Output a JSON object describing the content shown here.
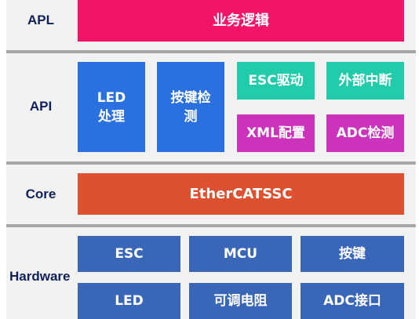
{
  "layers": {
    "apl": {
      "label": "APL",
      "box": {
        "text": "业务逻辑",
        "color": "#f31469"
      }
    },
    "api": {
      "label": "API",
      "led": {
        "line1": "LED",
        "line2": "处理",
        "color": "#2a70e0"
      },
      "key": {
        "line1": "按键检",
        "line2": "测",
        "color": "#2a70e0"
      },
      "esc_drive": {
        "text": "ESC驱动",
        "color": "#22ccaa"
      },
      "ext_int": {
        "text": "外部中断",
        "color": "#22ccaa"
      },
      "xml": {
        "text": "XML配置",
        "color": "#cc33bb"
      },
      "adc_detect": {
        "text": "ADC检测",
        "color": "#cc33bb"
      }
    },
    "core": {
      "label": "Core",
      "box": {
        "text": "EtherCATSSC",
        "color": "#dd5030"
      }
    },
    "hardware": {
      "label": "Hardware",
      "color": "#3a66b8",
      "cells": [
        "ESC",
        "MCU",
        "按键",
        "LED",
        "可调电阻",
        "ADC接口"
      ]
    }
  }
}
